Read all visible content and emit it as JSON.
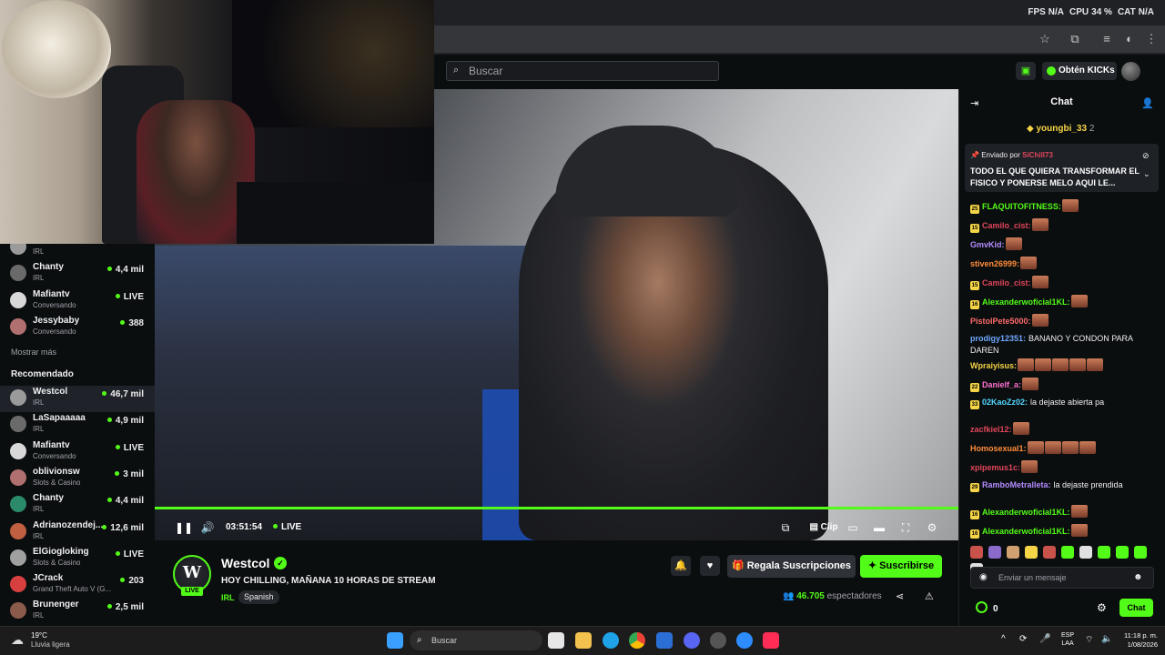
{
  "browser": {
    "overlay_stats": [
      {
        "label": "FPS",
        "value": "N/A"
      },
      {
        "label": "CPU",
        "value": "34 %"
      },
      {
        "label": "CAT",
        "value": "N/A"
      }
    ]
  },
  "header": {
    "search_placeholder": "Buscar",
    "kicks_label": "Obtén KICKs"
  },
  "sidebar": {
    "following": [
      {
        "name": "",
        "category": "IRL",
        "viewers": ""
      },
      {
        "name": "Chanty",
        "category": "IRL",
        "viewers": "4,4 mil"
      },
      {
        "name": "Mafiantv",
        "category": "Conversando",
        "viewers": "LIVE"
      },
      {
        "name": "Jessybaby",
        "category": "Conversando",
        "viewers": "388"
      }
    ],
    "show_more": "Mostrar más",
    "recommended_title": "Recomendado",
    "recommended": [
      {
        "name": "Westcol",
        "category": "IRL",
        "viewers": "46,7 mil",
        "active": true
      },
      {
        "name": "LaSapaaaaa",
        "category": "IRL",
        "viewers": "4,9 mil"
      },
      {
        "name": "Mafiantv",
        "category": "Conversando",
        "viewers": "LIVE"
      },
      {
        "name": "oblivionsw",
        "category": "Slots & Casino",
        "viewers": "3 mil"
      },
      {
        "name": "Chanty",
        "category": "IRL",
        "viewers": "4,4 mil"
      },
      {
        "name": "Adrianozendej...",
        "category": "IRL",
        "viewers": "12,6 mil"
      },
      {
        "name": "ElGiogloking",
        "category": "Slots & Casino",
        "viewers": "LIVE"
      },
      {
        "name": "JCrack",
        "category": "Grand Theft Auto V (G...",
        "viewers": "203"
      },
      {
        "name": "Brunenger",
        "category": "IRL",
        "viewers": "2,5 mil"
      }
    ]
  },
  "player": {
    "elapsed": "03:51:54",
    "live_label": "LIVE",
    "clip_label": "Clip",
    "progress": 1.0
  },
  "stream": {
    "channel": "Westcol",
    "title": "HOY CHILLING, MAÑANA 10 HORAS DE STREAM",
    "category": "IRL",
    "language": "Spanish",
    "live_badge": "LIVE",
    "gift_label": "Regala Suscripciones",
    "subscribe_label": "Suscribirse",
    "viewers_count": "46.705",
    "viewers_label": "espectadores"
  },
  "chat": {
    "title": "Chat",
    "top_gifter": "youngbi_33",
    "top_gifter_count": "2",
    "pinned_by_label": "Enviado por",
    "pinned_user": "SiChill73",
    "pinned_text": "TODO EL QUE QUIERA TRANSFORMAR EL FISICO Y PONERSE MELO AQUI LE...",
    "messages": [
      {
        "user": "FLAQUITOFITNESS:",
        "color": "#53fc18",
        "badge": "25",
        "text": "",
        "emotes": 1
      },
      {
        "user": "Camilo_cist:",
        "color": "#e0465a",
        "badge": "15",
        "text": "",
        "emotes": 1
      },
      {
        "user": "GmvKid:",
        "color": "#b28cff",
        "badge": "",
        "text": "",
        "emotes": 1
      },
      {
        "user": "stiven26999:",
        "color": "#ff8c3a",
        "badge": "",
        "text": "",
        "emotes": 1
      },
      {
        "user": "Camilo_cist:",
        "color": "#e0465a",
        "badge": "15",
        "text": "",
        "emotes": 1
      },
      {
        "user": "Alexanderwoficial1KL:",
        "color": "#53fc18",
        "badge": "16",
        "text": "",
        "emotes": 1
      },
      {
        "user": "PistolPete5000:",
        "color": "#ff6b6b",
        "badge": "",
        "text": "",
        "emotes": 1
      },
      {
        "user": "prodigy12351:",
        "color": "#6fa8ff",
        "badge": "",
        "text": "BANANO Y CONDON PARA DAREN",
        "emotes": 0
      },
      {
        "user": "Wpraiyisus:",
        "color": "#f5d547",
        "badge": "",
        "text": "",
        "emotes": 5
      },
      {
        "user": "Danielf_a:",
        "color": "#ff6fd0",
        "badge": "22",
        "text": "",
        "emotes": 1
      },
      {
        "user": "02KaoZz02:",
        "color": "#53d7ff",
        "badge": "33",
        "text": "la dejaste abierta pa",
        "emotes": 0
      },
      {
        "user": "zacfkiel12:",
        "color": "#e0465a",
        "badge": "",
        "text": "",
        "emotes": 1
      },
      {
        "user": "Homosexual1:",
        "color": "#ff8c3a",
        "badge": "",
        "text": "",
        "emotes": 4
      },
      {
        "user": "xpipemus1c:",
        "color": "#e0465a",
        "badge": "",
        "text": "",
        "emotes": 1
      },
      {
        "user": "RamboMetralleta:",
        "color": "#b28cff",
        "badge": "29",
        "text": "la dejaste prendida",
        "emotes": 0
      },
      {
        "user": "Alexanderwoficial1KL:",
        "color": "#53fc18",
        "badge": "16",
        "text": "",
        "emotes": 1
      },
      {
        "user": "Alexanderwoficial1KL:",
        "color": "#53fc18",
        "badge": "16",
        "text": "",
        "emotes": 1
      }
    ],
    "input_placeholder": "Enviar un mensaje",
    "points": "0",
    "send_label": "Chat"
  },
  "taskbar": {
    "weather_temp": "19°C",
    "weather_desc": "Lluvia ligera",
    "search_placeholder": "Buscar",
    "lang_line1": "ESP",
    "lang_line2": "LAA",
    "time": "11:18 p. m.",
    "date": "1/08/2026"
  }
}
